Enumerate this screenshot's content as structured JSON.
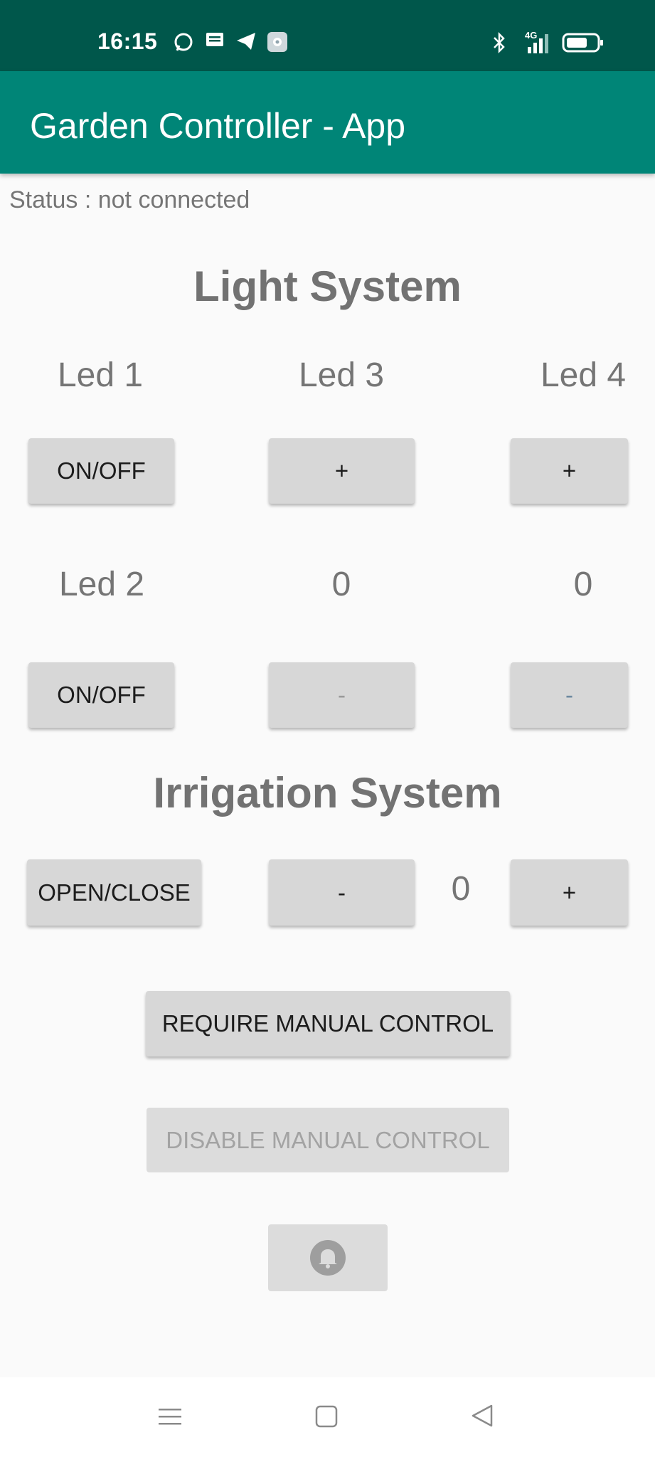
{
  "status_bar": {
    "time": "16:15",
    "icons": [
      "whatsapp-icon",
      "message-icon",
      "telegram-icon",
      "settings-app-icon",
      "bluetooth-icon",
      "signal-4g-icon",
      "battery-icon"
    ],
    "network": "4G"
  },
  "app_bar": {
    "title": "Garden Controller - App"
  },
  "status": {
    "text": "Status : not connected"
  },
  "light_system": {
    "title": "Light System",
    "led1_label": "Led 1",
    "led2_label": "Led 2",
    "led3_label": "Led 3",
    "led4_label": "Led 4",
    "onoff_label": "ON/OFF",
    "plus_label": "+",
    "minus_label": "-",
    "led3_value": "0",
    "led4_value": "0"
  },
  "irrigation_system": {
    "title": "Irrigation System",
    "open_close_label": "OPEN/CLOSE",
    "minus_label": "-",
    "plus_label": "+",
    "value": "0"
  },
  "manual_control": {
    "require_label": "REQUIRE MANUAL CONTROL",
    "disable_label": "DISABLE MANUAL CONTROL"
  },
  "notification_button": {
    "icon": "bell-icon"
  },
  "nav_bar": {
    "icons": [
      "menu-icon",
      "home-icon",
      "back-icon"
    ]
  }
}
